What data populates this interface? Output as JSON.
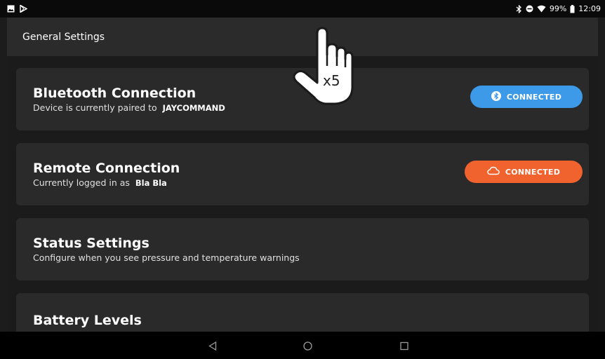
{
  "status_bar": {
    "battery_percent": "99%",
    "time": "12:09",
    "icons": [
      "image-icon",
      "play-store-icon",
      "bluetooth-icon",
      "do-not-disturb-icon",
      "wifi-icon",
      "battery-icon"
    ]
  },
  "app_bar": {
    "title": "General Settings"
  },
  "cards": [
    {
      "title": "Bluetooth Connection",
      "subtitle": "Device is currently paired to",
      "subtitle_value": "JAYCOMMAND",
      "button_label": "CONNECTED",
      "button_icon": "bluetooth-icon",
      "button_color": "#3d9ae8"
    },
    {
      "title": "Remote Connection",
      "subtitle": "Currently logged in as",
      "subtitle_value": "Bla Bla",
      "button_label": "CONNECTED",
      "button_icon": "cloud-icon",
      "button_color": "#f0622e"
    },
    {
      "title": "Status Settings",
      "subtitle": "Configure when you see pressure and temperature warnings"
    },
    {
      "title": "Battery Levels"
    }
  ],
  "gesture_overlay": {
    "icon": "tap-hand-icon",
    "label": "x5"
  },
  "nav_bar": {
    "icons": [
      "back-icon",
      "home-icon",
      "recents-icon"
    ]
  }
}
